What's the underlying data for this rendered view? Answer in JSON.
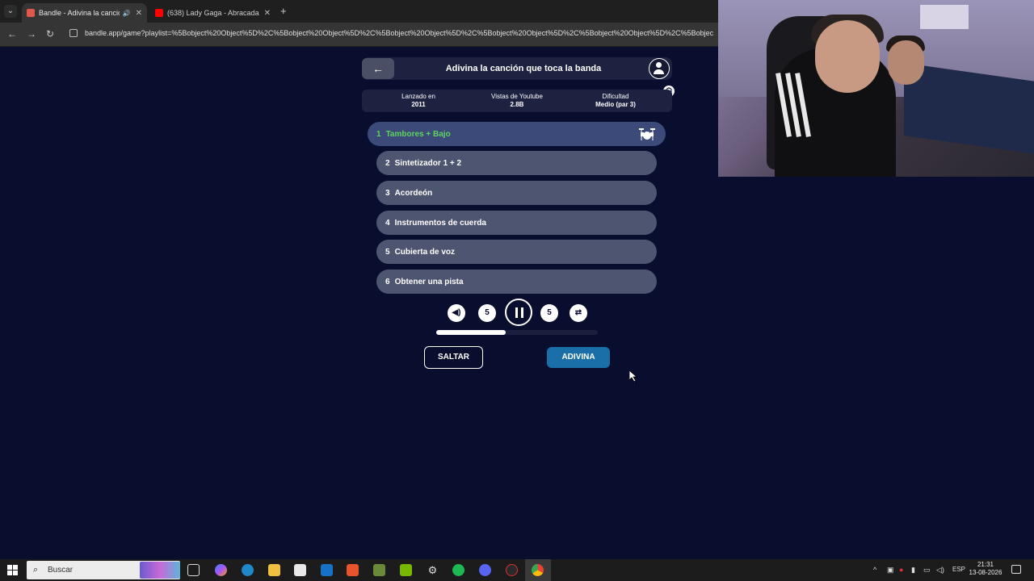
{
  "browser": {
    "tabs": [
      {
        "title": "Bandle - Adivina la canción",
        "active": true
      },
      {
        "title": "(638) Lady Gaga - Abracadabra",
        "active": false
      }
    ],
    "url": "bandle.app/game?playlist=%5Bobject%20Object%5D%2C%5Bobject%20Object%5D%2C%5Bobject%20Object%5D%2C%5Bobject%20Object%5D%2C%5Bobject%20Object%5D%2C%5Bobjec"
  },
  "game": {
    "title": "Adivina la canción que toca la banda",
    "info": [
      {
        "label": "Lanzado en",
        "value": "2011"
      },
      {
        "label": "Vistas de Youtube",
        "value": "2.8B"
      },
      {
        "label": "Dificultad",
        "value": "Medio (par 3)"
      }
    ],
    "clues": [
      {
        "num": "1",
        "label": "Tambores + Bajo",
        "active": true
      },
      {
        "num": "2",
        "label": "Sintetizador 1 + 2",
        "active": false
      },
      {
        "num": "3",
        "label": "Acordeón",
        "active": false
      },
      {
        "num": "4",
        "label": "Instrumentos de cuerda",
        "active": false
      },
      {
        "num": "5",
        "label": "Cubierta de voz",
        "active": false
      },
      {
        "num": "6",
        "label": "Obtener una pista",
        "active": false
      }
    ],
    "controls": {
      "rewind_seconds": "5",
      "forward_seconds": "5",
      "progress": 0.43
    },
    "skip_label": "SALTAR",
    "guess_label": "ADIVINA"
  },
  "taskbar": {
    "search_placeholder": "Buscar",
    "language": "ESP",
    "time": "21:31",
    "date": "13-08-2026"
  },
  "colors": {
    "background": "#0a0e2e",
    "active_clue_text": "#5fd35f",
    "guess_button": "#1a6fa8"
  }
}
